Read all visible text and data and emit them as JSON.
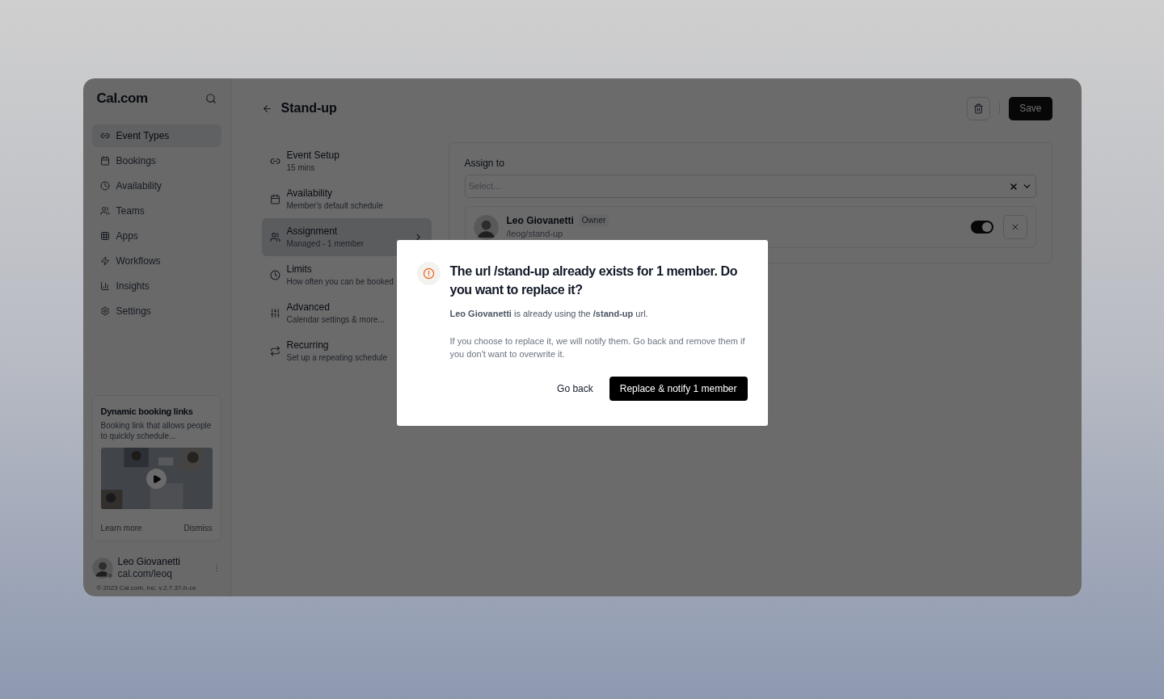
{
  "sidebar": {
    "logo": "Cal.com",
    "nav": [
      {
        "label": "Event Types",
        "selected": true
      },
      {
        "label": "Bookings",
        "selected": false
      },
      {
        "label": "Availability",
        "selected": false
      },
      {
        "label": "Teams",
        "selected": false
      },
      {
        "label": "Apps",
        "selected": false
      },
      {
        "label": "Workflows",
        "selected": false
      },
      {
        "label": "Insights",
        "selected": false
      },
      {
        "label": "Settings",
        "selected": false
      }
    ],
    "promo": {
      "title": "Dynamic booking links",
      "text": "Booking link that allows people to quickly schedule...",
      "learn_more": "Learn more",
      "dismiss": "Dismiss"
    },
    "user": {
      "name": "Leo Giovanetti",
      "link": "cal.com/leoq",
      "online": true
    },
    "footer": "© 2023 Cal.com, Inc. v.2.7.37-h-ce"
  },
  "header": {
    "title": "Stand-up",
    "save": "Save"
  },
  "event_menu": [
    {
      "title": "Event Setup",
      "subtitle": "15 mins",
      "selected": false
    },
    {
      "title": "Availability",
      "subtitle": "Member's default schedule",
      "selected": false
    },
    {
      "title": "Assignment",
      "subtitle": "Managed - 1 member",
      "selected": true
    },
    {
      "title": "Limits",
      "subtitle": "How often you can be booked",
      "selected": false
    },
    {
      "title": "Advanced",
      "subtitle": "Calendar settings & more...",
      "selected": false
    },
    {
      "title": "Recurring",
      "subtitle": "Set up a repeating schedule",
      "selected": false
    }
  ],
  "assign": {
    "label": "Assign to",
    "placeholder": "Select...",
    "members": [
      {
        "name": "Leo Giovanetti",
        "badge": "Owner",
        "url": "/leog/stand-up",
        "on": true
      }
    ]
  },
  "dialog": {
    "title": "The url /stand-up already exists for 1 member. Do you want to replace it?",
    "message": "**Leo Giovanetti** is already using the **/stand-up** url.",
    "note": "If you choose to replace it, we will notify them. Go back and remove them if you don't want to overwrite it.",
    "cancel": "Go back",
    "confirm": "Replace & notify 1 member"
  }
}
